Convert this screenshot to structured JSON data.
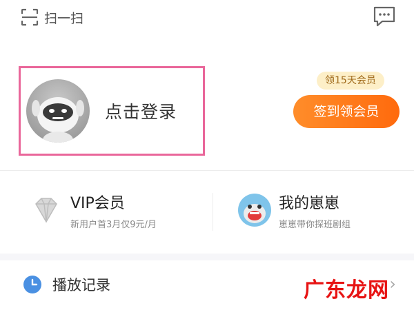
{
  "top_bar": {
    "scan_label": "扫一扫",
    "scan_icon": "scan-icon",
    "message_icon": "message-icon"
  },
  "login": {
    "label": "点击登录",
    "avatar_icon": "robot-avatar"
  },
  "vip_promo": {
    "tip": "领15天会员",
    "sign_button": "签到领会员"
  },
  "cards": {
    "vip": {
      "title": "VIP会员",
      "subtitle": "新用户首3月仅9元/月",
      "icon": "diamond-icon"
    },
    "huihui": {
      "title": "我的崽崽",
      "subtitle": "崽崽带你探班剧组",
      "icon": "mascot-icon"
    }
  },
  "history": {
    "label": "播放记录",
    "icon": "clock-icon"
  },
  "watermark": "广东龙网",
  "colors": {
    "highlight_border": "#e9669a",
    "orange": "#ff7a1a",
    "tip_bg": "#fdefc8",
    "clock_blue": "#4a90e2"
  }
}
